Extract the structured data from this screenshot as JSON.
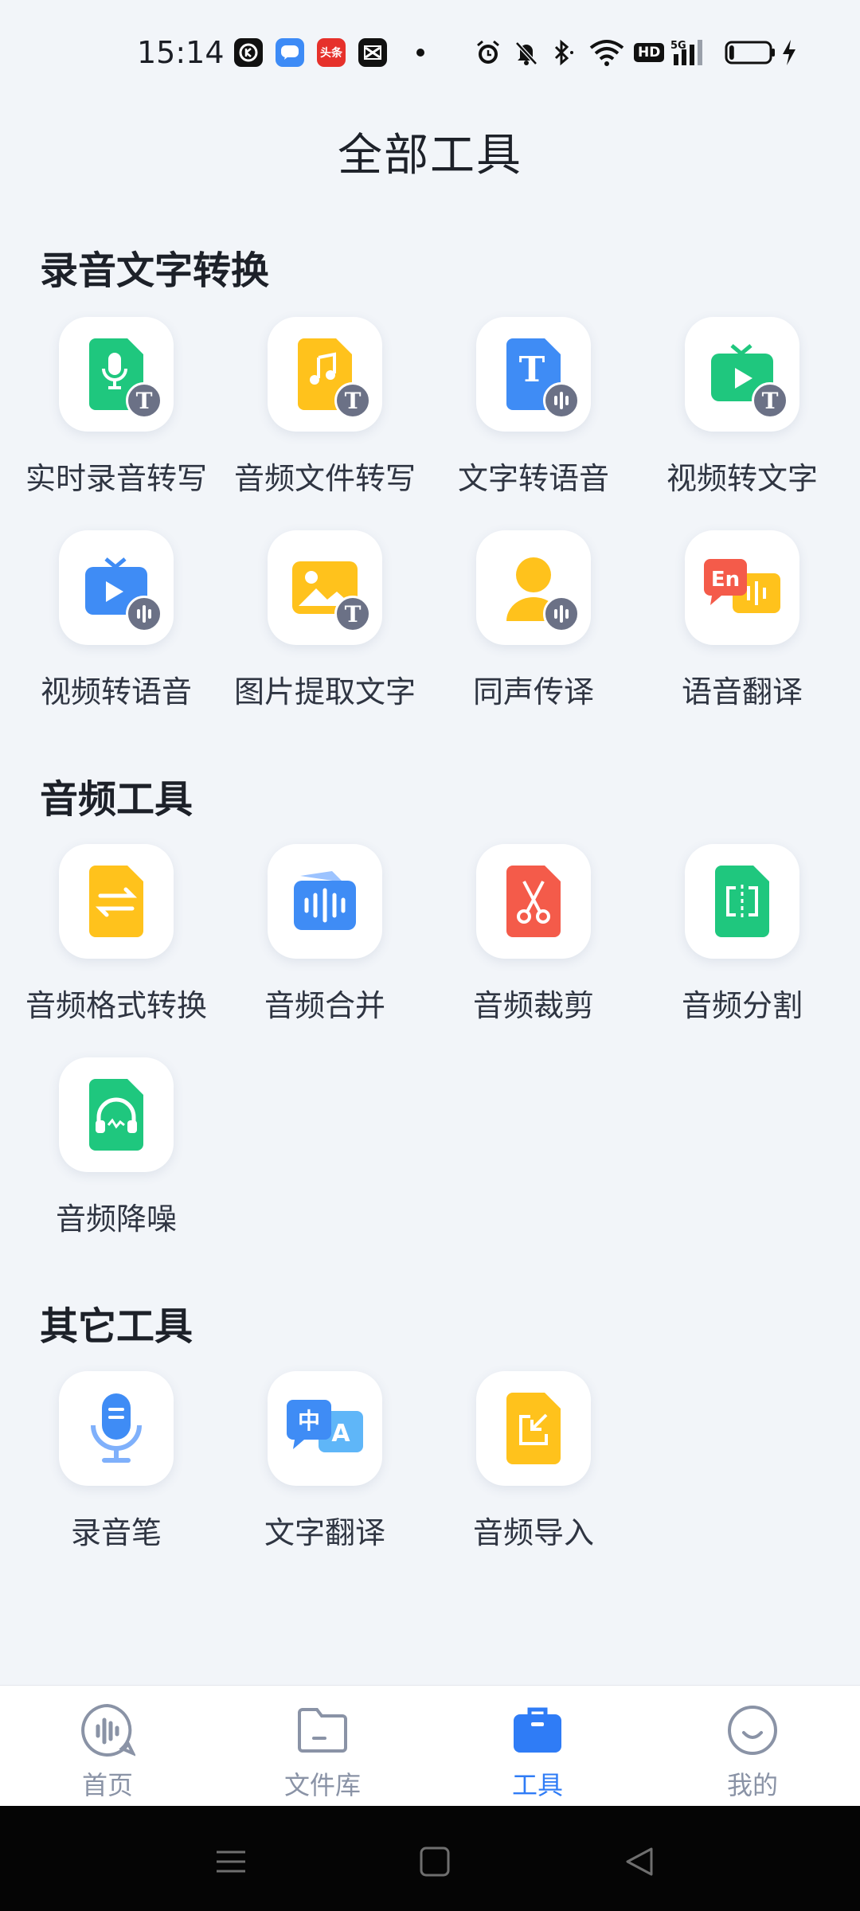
{
  "status_bar": {
    "time": "15:14",
    "notification_apps": [
      "kuaishou-app-icon",
      "message-app-icon",
      "toutiao-app-icon",
      "capcut-app-icon"
    ],
    "toutiao_label": "头条",
    "system_icons": [
      "alarm-icon",
      "mute-icon",
      "bluetooth-icon",
      "wifi-icon",
      "hd-icon",
      "signal-5g-icon",
      "battery-icon",
      "charging-icon"
    ],
    "hd_label": "HD",
    "network_label": "5G",
    "battery_percent": 8
  },
  "page": {
    "title": "全部工具"
  },
  "sections": [
    {
      "title": "录音文字转换",
      "tools": [
        {
          "label": "实时录音转写",
          "icon": "mic-to-text-icon",
          "color": "#1fc77e"
        },
        {
          "label": "音频文件转写",
          "icon": "audio-file-to-text-icon",
          "color": "#ffc21c"
        },
        {
          "label": "文字转语音",
          "icon": "text-to-speech-icon",
          "color": "#3f8cf5"
        },
        {
          "label": "视频转文字",
          "icon": "video-to-text-icon",
          "color": "#1fc77e"
        },
        {
          "label": "视频转语音",
          "icon": "video-to-speech-icon",
          "color": "#3f8cf5"
        },
        {
          "label": "图片提取文字",
          "icon": "image-to-text-icon",
          "color": "#ffc21c"
        },
        {
          "label": "同声传译",
          "icon": "simultaneous-interpretation-icon",
          "color": "#ffc21c"
        },
        {
          "label": "语音翻译",
          "icon": "voice-translation-icon",
          "color": "#f45b4a"
        }
      ]
    },
    {
      "title": "音频工具",
      "tools": [
        {
          "label": "音频格式转换",
          "icon": "audio-format-convert-icon",
          "color": "#ffc21c"
        },
        {
          "label": "音频合并",
          "icon": "audio-merge-icon",
          "color": "#3f8cf5"
        },
        {
          "label": "音频裁剪",
          "icon": "audio-cut-icon",
          "color": "#f45b4a"
        },
        {
          "label": "音频分割",
          "icon": "audio-split-icon",
          "color": "#1fc77e"
        },
        {
          "label": "音频降噪",
          "icon": "audio-denoise-icon",
          "color": "#1fc77e"
        }
      ]
    },
    {
      "title": "其它工具",
      "tools": [
        {
          "label": "录音笔",
          "icon": "voice-recorder-icon",
          "color": "#3f8cf5"
        },
        {
          "label": "文字翻译",
          "icon": "text-translation-icon",
          "color": "#3f8cf5"
        },
        {
          "label": "音频导入",
          "icon": "audio-import-icon",
          "color": "#ffc21c"
        }
      ]
    }
  ],
  "icon_text": {
    "t": "T",
    "en": "En",
    "zh": "中",
    "a": "A"
  },
  "tabbar": [
    {
      "label": "首页",
      "icon": "home-voice-icon",
      "active": false
    },
    {
      "label": "文件库",
      "icon": "folder-icon",
      "active": false
    },
    {
      "label": "工具",
      "icon": "toolbox-icon",
      "active": true
    },
    {
      "label": "我的",
      "icon": "profile-smile-icon",
      "active": false
    }
  ],
  "nav_bar": [
    "menu-icon",
    "home-square-icon",
    "back-triangle-icon"
  ],
  "colors": {
    "accent": "#2f7cf6",
    "background": "#f2f5f9",
    "inactive_tab": "#8a93a6"
  }
}
